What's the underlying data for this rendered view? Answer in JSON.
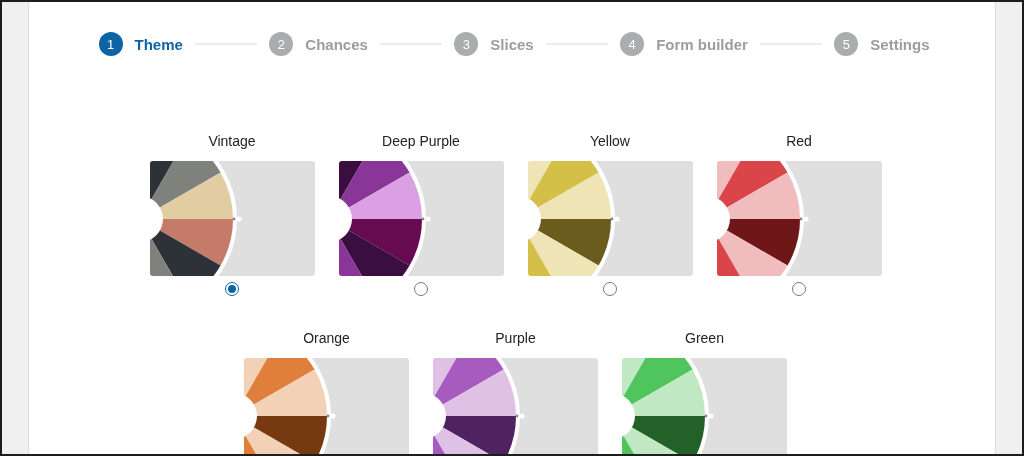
{
  "steps": [
    {
      "number": "1",
      "label": "Theme",
      "selected": true
    },
    {
      "number": "2",
      "label": "Chances",
      "selected": false
    },
    {
      "number": "3",
      "label": "Slices",
      "selected": false
    },
    {
      "number": "4",
      "label": "Form builder",
      "selected": false
    },
    {
      "number": "5",
      "label": "Settings",
      "selected": false
    }
  ],
  "themes": [
    {
      "name": "Vintage",
      "selected": true,
      "slices": [
        {
          "color": "#2d3238"
        },
        {
          "color": "#7e817c"
        },
        {
          "color": "#e2cda3"
        },
        {
          "color": "#c57b6a"
        },
        {
          "color": "#2d3238"
        },
        {
          "color": "#7e817c"
        }
      ]
    },
    {
      "name": "Deep Purple",
      "selected": false,
      "slices": [
        {
          "color": "#3a0e3f"
        },
        {
          "color": "#8a3598"
        },
        {
          "color": "#dba0e3"
        },
        {
          "color": "#660b50"
        },
        {
          "color": "#3a0e3f"
        },
        {
          "color": "#8a3598"
        }
      ]
    },
    {
      "name": "Yellow",
      "selected": false,
      "slices": [
        {
          "color": "#eee4b5"
        },
        {
          "color": "#d4bf48"
        },
        {
          "color": "#eee4b5"
        },
        {
          "color": "#6b5c1e"
        },
        {
          "color": "#eee4b5"
        },
        {
          "color": "#d4bf48"
        }
      ]
    },
    {
      "name": "Red",
      "selected": false,
      "slices": [
        {
          "color": "#f0bcbd"
        },
        {
          "color": "#da4549"
        },
        {
          "color": "#f0bcbd"
        },
        {
          "color": "#6e1618"
        },
        {
          "color": "#f0bcbd"
        },
        {
          "color": "#da4549"
        }
      ]
    },
    {
      "name": "Orange",
      "slices": [
        {
          "color": "#f3d1b7"
        },
        {
          "color": "#e07f3c"
        },
        {
          "color": "#f3d1b7"
        },
        {
          "color": "#77390f"
        },
        {
          "color": "#f3d1b7"
        },
        {
          "color": "#e07f3c"
        }
      ]
    },
    {
      "name": "Purple",
      "slices": [
        {
          "color": "#dfc1e5"
        },
        {
          "color": "#a75bbf"
        },
        {
          "color": "#dfc1e5"
        },
        {
          "color": "#4f2260"
        },
        {
          "color": "#dfc1e5"
        },
        {
          "color": "#a75bbf"
        }
      ]
    },
    {
      "name": "Green",
      "slices": [
        {
          "color": "#bfe8c3"
        },
        {
          "color": "#50c45d"
        },
        {
          "color": "#bfe8c3"
        },
        {
          "color": "#226128"
        },
        {
          "color": "#bfe8c3"
        },
        {
          "color": "#50c45d"
        }
      ]
    }
  ]
}
